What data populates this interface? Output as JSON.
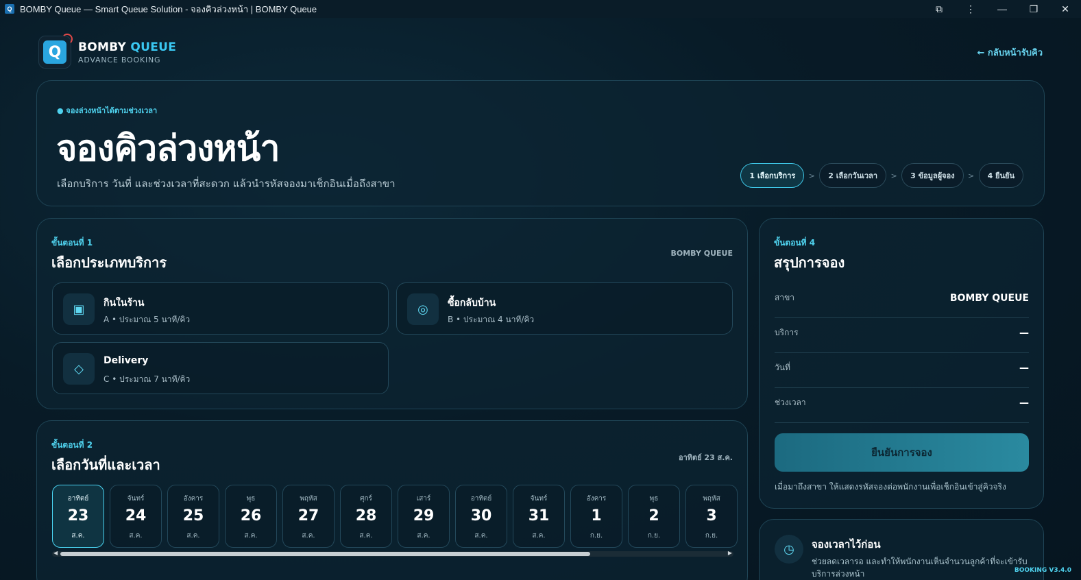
{
  "window": {
    "title": "BOMBY Queue — Smart Queue Solution - จองคิวล่วงหน้า | BOMBY Queue",
    "app_icon_glyph": "Q"
  },
  "brand": {
    "name_part1": "BOMBY",
    "name_part2": "QUEUE",
    "subtitle": "ADVANCE BOOKING",
    "logo_glyph": "Q"
  },
  "back_link": "← กลับหน้ารับคิว",
  "hero": {
    "eyebrow": "● จองล่วงหน้าได้ตามช่วงเวลา",
    "title": "จองคิวล่วงหน้า",
    "lead": "เลือกบริการ วันที่ และช่วงเวลาที่สะดวก แล้วนำรหัสจองมาเช็กอินเมื่อถึงสาขา",
    "steps": [
      {
        "label": "1 เลือกบริการ",
        "active": true
      },
      {
        "label": "2 เลือกวันเวลา",
        "active": false
      },
      {
        "label": "3 ข้อมูลผู้จอง",
        "active": false
      },
      {
        "label": "4 ยืนยัน",
        "active": false
      }
    ],
    "step_separator": ">"
  },
  "section1": {
    "eyebrow": "ขั้นตอนที่ 1",
    "title": "เลือกประเภทบริการ",
    "branch": "BOMBY QUEUE",
    "services": [
      {
        "icon": "store-icon",
        "glyph": "▣",
        "name": "กินในร้าน",
        "meta": "A • ประมาณ 5 นาที/คิว"
      },
      {
        "icon": "takeaway-icon",
        "glyph": "◎",
        "name": "ซื้อกลับบ้าน",
        "meta": "B • ประมาณ 4 นาที/คิว"
      },
      {
        "icon": "delivery-icon",
        "glyph": "◇",
        "name": "Delivery",
        "meta": "C • ประมาณ 7 นาที/คิว"
      }
    ]
  },
  "section2": {
    "eyebrow": "ขั้นตอนที่ 2",
    "title": "เลือกวันที่และเวลา",
    "selected_date": "อาทิตย์ 23 ส.ค.",
    "dates": [
      {
        "dow": "อาทิตย์",
        "day": "23",
        "mon": "ส.ค.",
        "selected": true
      },
      {
        "dow": "จันทร์",
        "day": "24",
        "mon": "ส.ค.",
        "selected": false
      },
      {
        "dow": "อังคาร",
        "day": "25",
        "mon": "ส.ค.",
        "selected": false
      },
      {
        "dow": "พุธ",
        "day": "26",
        "mon": "ส.ค.",
        "selected": false
      },
      {
        "dow": "พฤหัส",
        "day": "27",
        "mon": "ส.ค.",
        "selected": false
      },
      {
        "dow": "ศุกร์",
        "day": "28",
        "mon": "ส.ค.",
        "selected": false
      },
      {
        "dow": "เสาร์",
        "day": "29",
        "mon": "ส.ค.",
        "selected": false
      },
      {
        "dow": "อาทิตย์",
        "day": "30",
        "mon": "ส.ค.",
        "selected": false
      },
      {
        "dow": "จันทร์",
        "day": "31",
        "mon": "ส.ค.",
        "selected": false
      },
      {
        "dow": "อังคาร",
        "day": "1",
        "mon": "ก.ย.",
        "selected": false
      },
      {
        "dow": "พุธ",
        "day": "2",
        "mon": "ก.ย.",
        "selected": false
      },
      {
        "dow": "พฤหัส",
        "day": "3",
        "mon": "ก.ย.",
        "selected": false
      }
    ]
  },
  "summary": {
    "eyebrow": "ขั้นตอนที่ 4",
    "title": "สรุปการจอง",
    "rows": [
      {
        "key": "สาขา",
        "value": "BOMBY QUEUE"
      },
      {
        "key": "บริการ",
        "value": "—"
      },
      {
        "key": "วันที่",
        "value": "—"
      },
      {
        "key": "ช่วงเวลา",
        "value": "—"
      }
    ],
    "confirm_label": "ยืนยันการจอง",
    "note": "เมื่อมาถึงสาขา ให้แสดงรหัสจองต่อพนักงานเพื่อเช็กอินเข้าสู่คิวจริง"
  },
  "tip": {
    "title": "จองเวลาไว้ก่อน",
    "text": "ช่วยลดเวลารอ และทำให้พนักงานเห็นจำนวนลูกค้าที่จะเข้ารับบริการล่วงหน้า",
    "icon": "clock-icon",
    "glyph": "◷"
  },
  "version": "BOOKING V3.4.0",
  "colors": {
    "accent": "#3ac8f2",
    "background": "#081b27",
    "card_border": "#1f4556"
  }
}
